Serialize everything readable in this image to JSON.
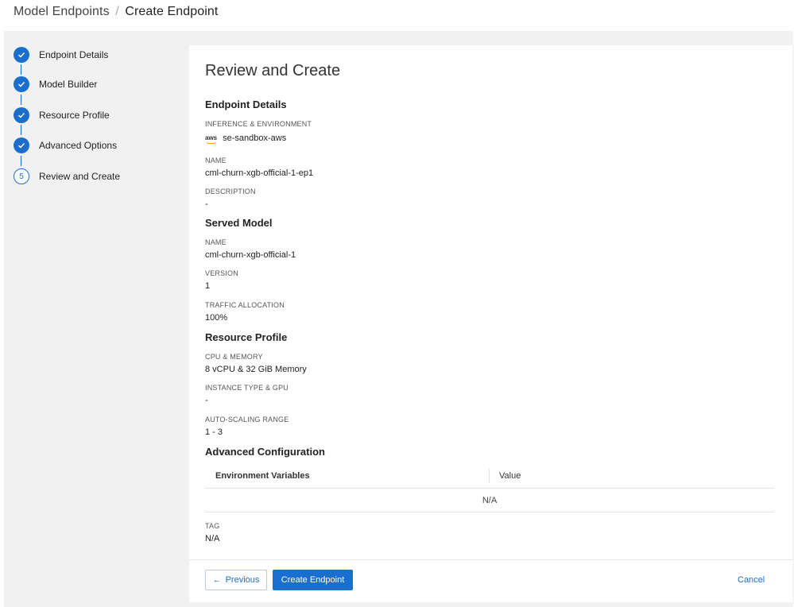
{
  "breadcrumb": {
    "parent": "Model Endpoints",
    "separator": "/",
    "current": "Create Endpoint"
  },
  "stepper": {
    "steps": [
      {
        "label": "Endpoint Details",
        "status": "complete"
      },
      {
        "label": "Model Builder",
        "status": "complete"
      },
      {
        "label": "Resource Profile",
        "status": "complete"
      },
      {
        "label": "Advanced Options",
        "status": "complete"
      },
      {
        "label": "Review and Create",
        "status": "current",
        "number": "5"
      }
    ]
  },
  "review": {
    "title": "Review and Create",
    "endpoint_details": {
      "heading": "Endpoint Details",
      "inference_label": "INFERENCE & ENVIRONMENT",
      "inference_logo": "aws",
      "inference_value": "se-sandbox-aws",
      "name_label": "NAME",
      "name_value": "cml-churn-xgb-official-1-ep1",
      "description_label": "DESCRIPTION",
      "description_value": "-"
    },
    "served_model": {
      "heading": "Served Model",
      "name_label": "NAME",
      "name_value": "cml-churn-xgb-official-1",
      "version_label": "VERSION",
      "version_value": "1",
      "traffic_label": "TRAFFIC ALLOCATION",
      "traffic_value": "100%"
    },
    "resource_profile": {
      "heading": "Resource Profile",
      "cpu_label": "CPU & MEMORY",
      "cpu_value": "8 vCPU & 32 GiB Memory",
      "instance_label": "INSTANCE TYPE & GPU",
      "instance_value": "-",
      "autoscale_label": "AUTO-SCALING RANGE",
      "autoscale_value": "1 - 3"
    },
    "advanced_configuration": {
      "heading": "Advanced Configuration",
      "columns": [
        "Environment Variables",
        "Value"
      ],
      "empty_text": "N/A",
      "tag_label": "TAG",
      "tag_value": "N/A"
    }
  },
  "footer": {
    "previous_label": "Previous",
    "previous_arrow": "←",
    "create_label": "Create Endpoint",
    "cancel_label": "Cancel"
  },
  "colors": {
    "accent": "#1a6fce",
    "panel_bg": "#f1f1f1",
    "card_bg": "#ffffff"
  }
}
